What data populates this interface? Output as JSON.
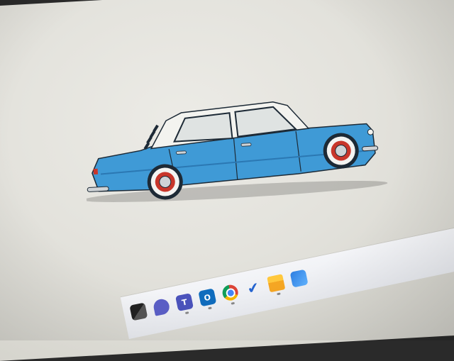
{
  "wallpaper": {
    "subject": "blue-sedan-illustration",
    "colors": {
      "body": "#3f9ad6",
      "body_shadow": "#2b78b3",
      "roof": "#f3f3ef",
      "trim": "#1d2a36",
      "wheel_white": "#f4f4f2",
      "wheel_red": "#c8362b",
      "chrome": "#cfd3d6"
    }
  },
  "taskbar": {
    "apps": [
      {
        "name": "task-view",
        "icon": "task-view-icon"
      },
      {
        "name": "chat",
        "icon": "chat-icon"
      },
      {
        "name": "teams",
        "icon": "teams-icon"
      },
      {
        "name": "outlook",
        "icon": "outlook-icon"
      },
      {
        "name": "chrome",
        "icon": "chrome-icon"
      },
      {
        "name": "todo",
        "icon": "todo-icon"
      },
      {
        "name": "file-explorer",
        "icon": "folder-icon"
      },
      {
        "name": "app",
        "icon": "app-icon"
      }
    ]
  }
}
